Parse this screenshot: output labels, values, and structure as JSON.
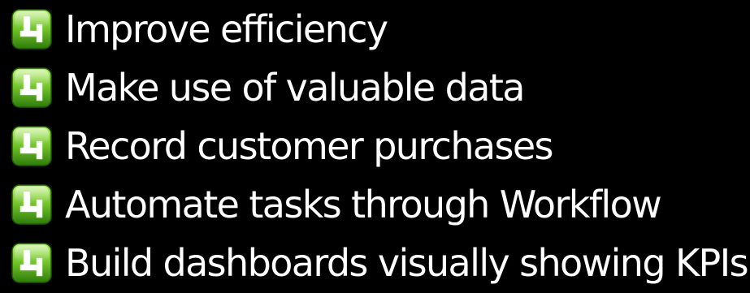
{
  "bullets": [
    {
      "icon": "number-4-logo-icon",
      "text": "Improve efficiency"
    },
    {
      "icon": "number-4-logo-icon",
      "text": "Make use of valuable data"
    },
    {
      "icon": "number-4-logo-icon",
      "text": "Record customer purchases"
    },
    {
      "icon": "number-4-logo-icon",
      "text": "Automate tasks through Workflow"
    },
    {
      "icon": "number-4-logo-icon",
      "text": "Build dashboards visually showing KPIs"
    }
  ],
  "colors": {
    "background": "#000000",
    "text": "#ffffff",
    "icon_green_light": "#a8e85a",
    "icon_green_dark": "#3f8f12",
    "icon_glyph": "#ffffff"
  }
}
